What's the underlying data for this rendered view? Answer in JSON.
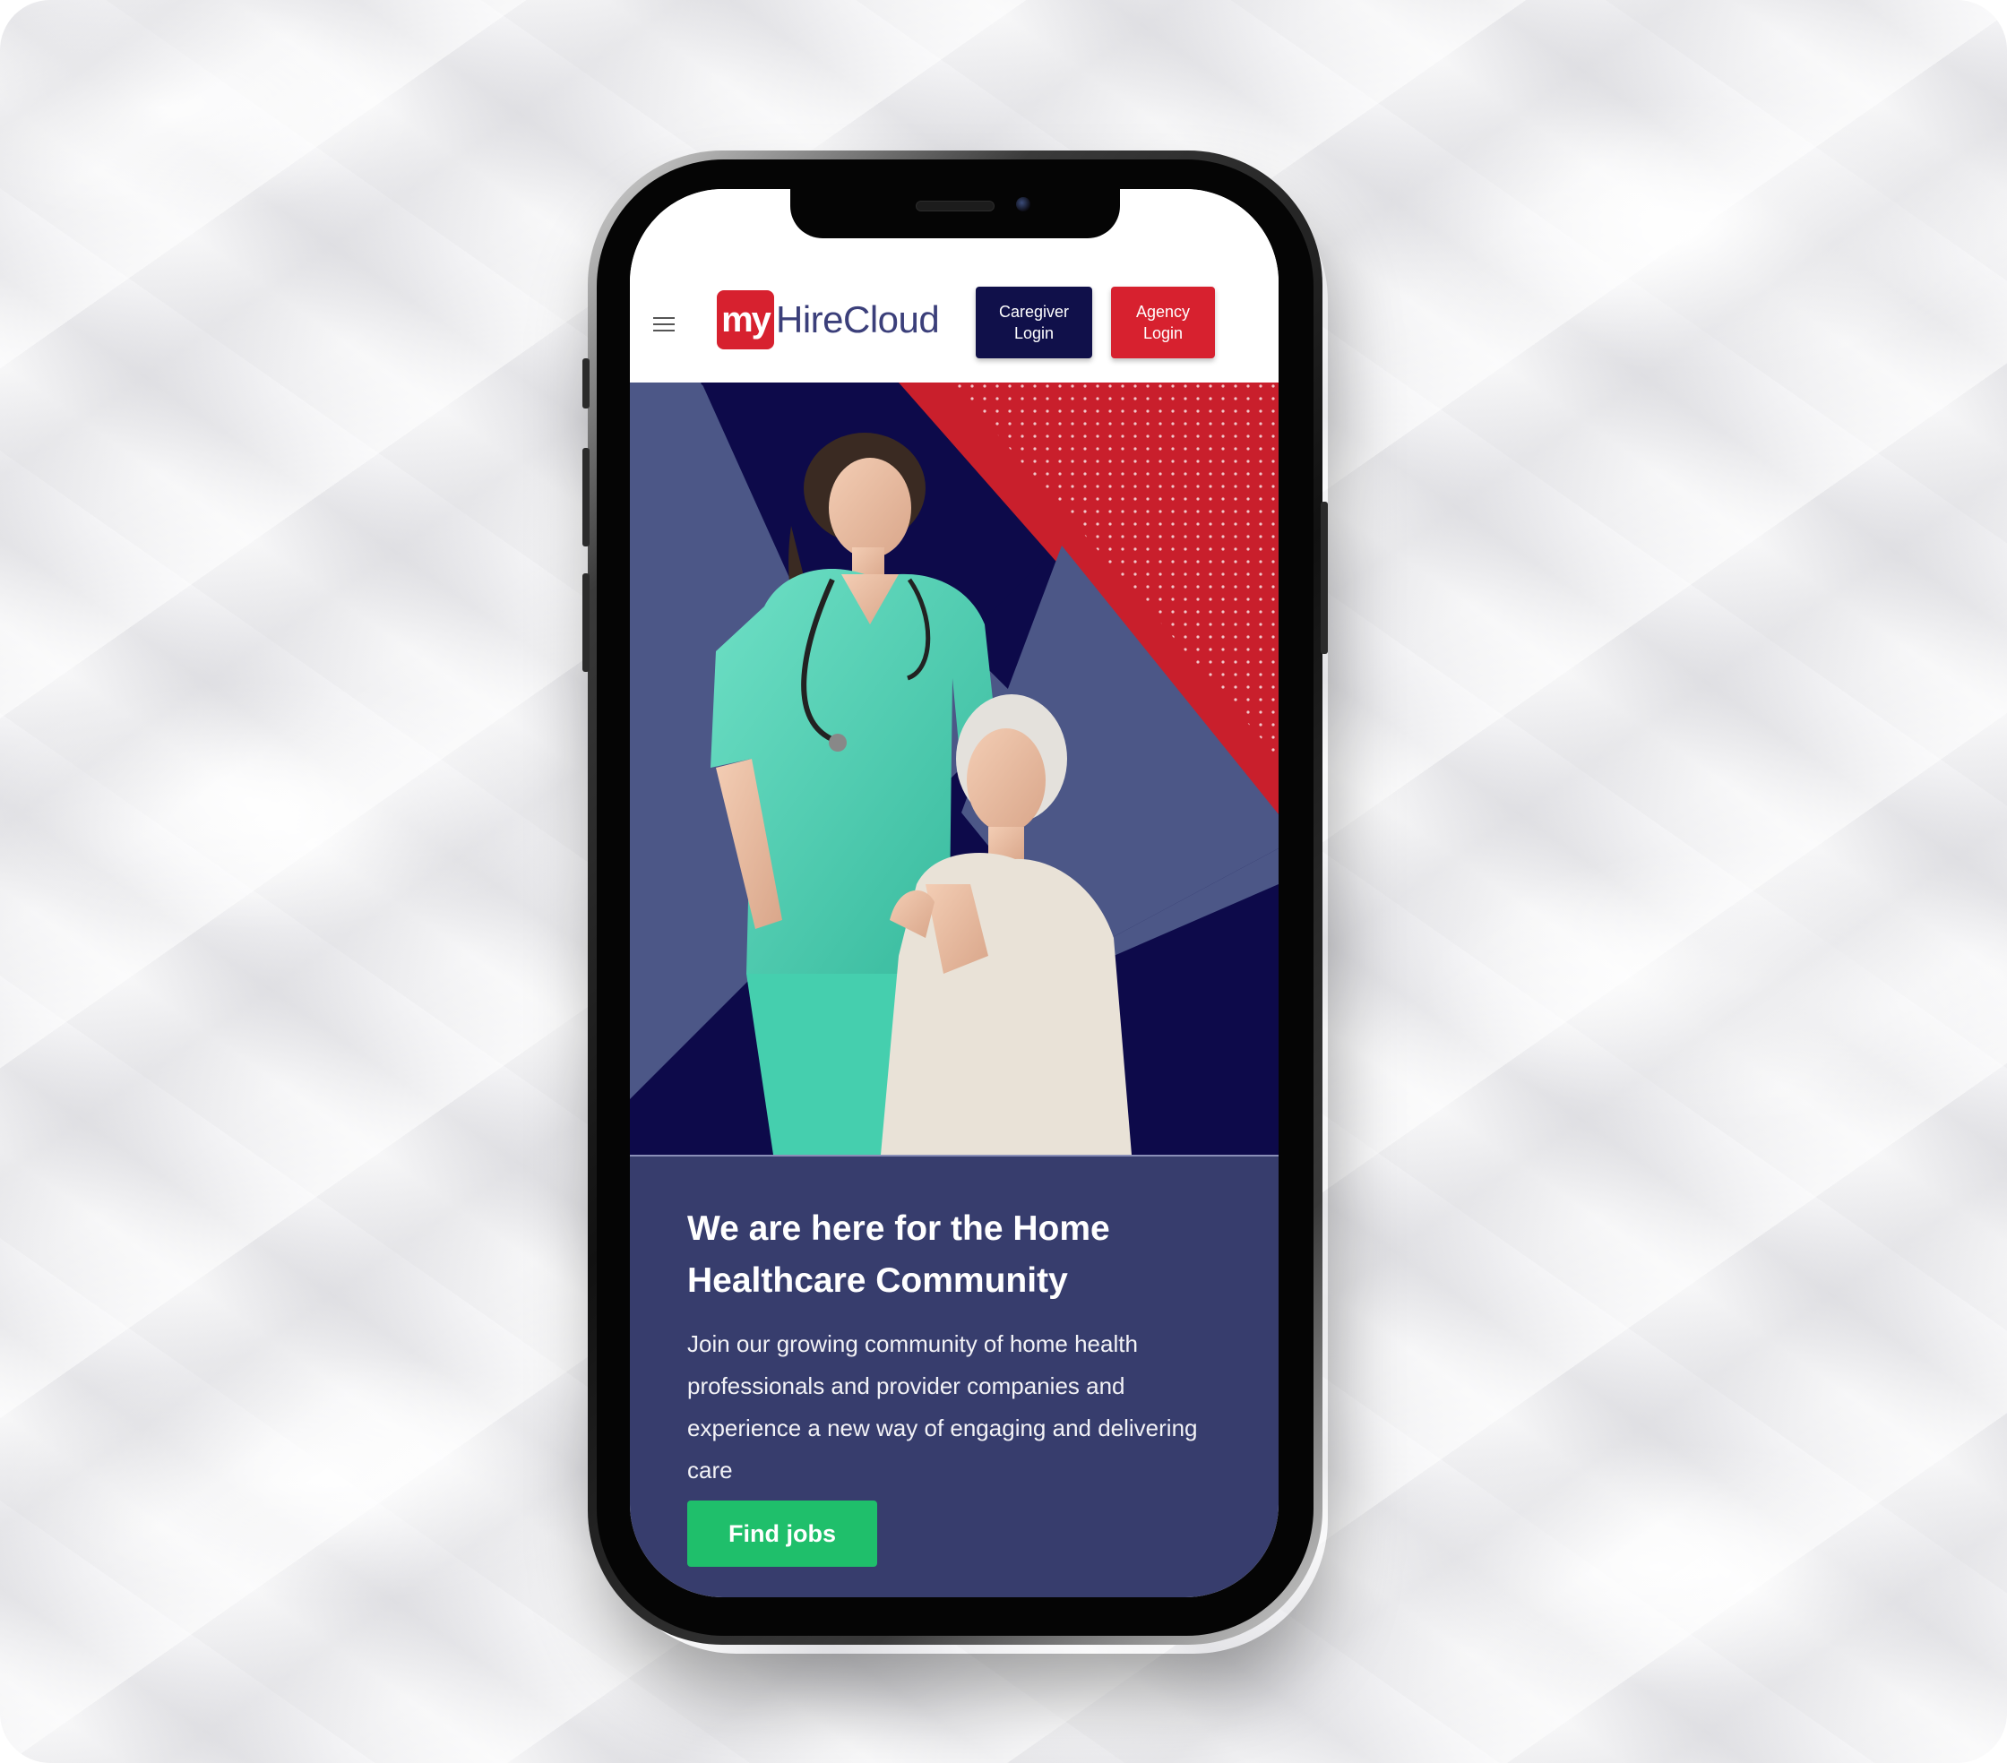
{
  "header": {
    "menu_icon": "hamburger-menu-icon",
    "logo": {
      "prefix": "my",
      "name": "HireCloud"
    },
    "caregiver_login": "Caregiver Login",
    "agency_login": "Agency Login"
  },
  "hero": {
    "image": "caregiver-with-elderly-woman-photo"
  },
  "content": {
    "headline": "We are here for the Home Healthcare Community",
    "description": "Join our growing community of home health professionals and provider companies and experience a new way of engaging and delivering care",
    "cta_label": "Find jobs"
  },
  "colors": {
    "brand_red": "#d7212f",
    "brand_navy": "#10104a",
    "section_bg": "#373d6d",
    "cta_green": "#1fbf6b"
  }
}
